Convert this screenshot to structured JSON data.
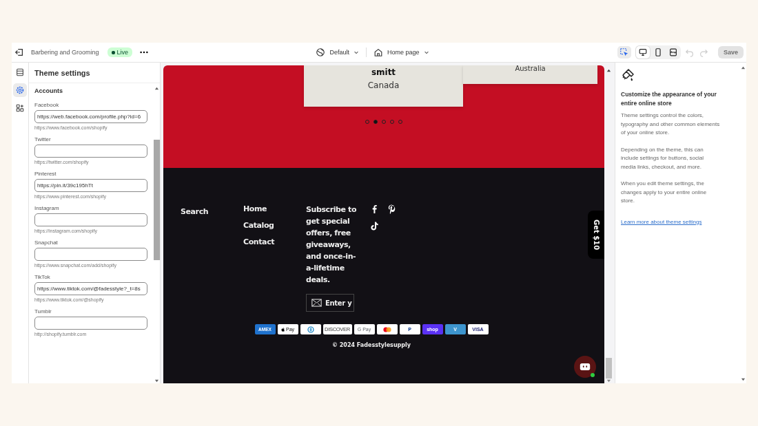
{
  "topbar": {
    "store_name": "Barbering and Grooming",
    "status_badge": "Live",
    "theme_menu": "Default",
    "page_menu": "Home page",
    "modes": [
      {
        "kind": "inspect",
        "selected": true
      }
    ],
    "views": [
      {
        "kind": "desktop",
        "selected": true
      },
      {
        "kind": "mobile",
        "selected": false
      },
      {
        "kind": "fullwidth",
        "selected": false
      }
    ],
    "undo_disabled": true,
    "redo_disabled": true,
    "save_button": {
      "label": "Save",
      "disabled": true
    }
  },
  "rail": [
    {
      "kind": "sections",
      "selected": false
    },
    {
      "kind": "settings",
      "selected": true
    },
    {
      "kind": "apps",
      "selected": false
    }
  ],
  "settings_panel": {
    "title": "Theme settings",
    "section_heading": "Accounts",
    "fields": [
      {
        "label": "Facebook",
        "value": "https://web.facebook.com/profile.php?id=6",
        "help": "https://www.facebook.com/shopify"
      },
      {
        "label": "Twitter",
        "help": "https://twitter.com/shopify"
      },
      {
        "label": "Pinterest",
        "value": "https://pin.it/39c195hTt",
        "help": "https://www.pinterest.com/shopify"
      },
      {
        "label": "Instagram",
        "help": "https://instagram.com/shopify"
      },
      {
        "label": "Snapchat",
        "help": "https://www.snapchat.com/add/shopify"
      },
      {
        "label": "TikTok",
        "value": "https://www.tiktok.com/@fadesstyle?_t=8s",
        "help": "https://www.tiktok.com/@shopify"
      },
      {
        "label": "Tumblr",
        "help": "http://shopify.tumblr.com"
      }
    ]
  },
  "preview": {
    "slides": [
      {
        "name": "smitt",
        "country": "Canada"
      },
      {
        "country": "Australia"
      }
    ],
    "dots": [
      {
        "selected": false
      },
      {
        "selected": true
      },
      {
        "selected": false
      },
      {
        "selected": false
      },
      {
        "selected": false
      }
    ],
    "footer": {
      "search_link": "Search",
      "menu_links": [
        "Home",
        "Catalog",
        "Contact"
      ],
      "newsletter_text": "Subscribe to get special offers, free giveaways, and once-in-a-lifetime deals.",
      "email_placeholder": "Enter y",
      "socials": [
        {
          "kind": "facebook"
        },
        {
          "kind": "pinterest"
        },
        {
          "kind": "tiktok"
        }
      ],
      "payment_methods": [
        {
          "kind": "amex",
          "label": "AMEX"
        },
        {
          "kind": "applepay",
          "label": "Pay"
        },
        {
          "kind": "diners"
        },
        {
          "kind": "discover",
          "label": "DISCOVER"
        },
        {
          "kind": "gpay",
          "label": "G Pay"
        },
        {
          "kind": "mastercard"
        },
        {
          "kind": "paypal",
          "label": "P"
        },
        {
          "kind": "shoppay",
          "label": "shop"
        },
        {
          "kind": "venmo",
          "label": "V"
        },
        {
          "kind": "visa",
          "label": "VISA"
        }
      ],
      "copyright": "© 2024 Fadesstylesupply"
    },
    "promo_tab": "Get $10"
  },
  "info_panel": {
    "heading": "Customize the appearance of your entire online store",
    "paragraphs": [
      "Theme settings control the colors, typography and other common elements of your online store.",
      "Depending on the theme, this can include settings for buttons, social media links, checkout, and more.",
      "When you edit theme settings, the changes apply to your entire online store."
    ],
    "link": "Learn more about theme settings"
  }
}
